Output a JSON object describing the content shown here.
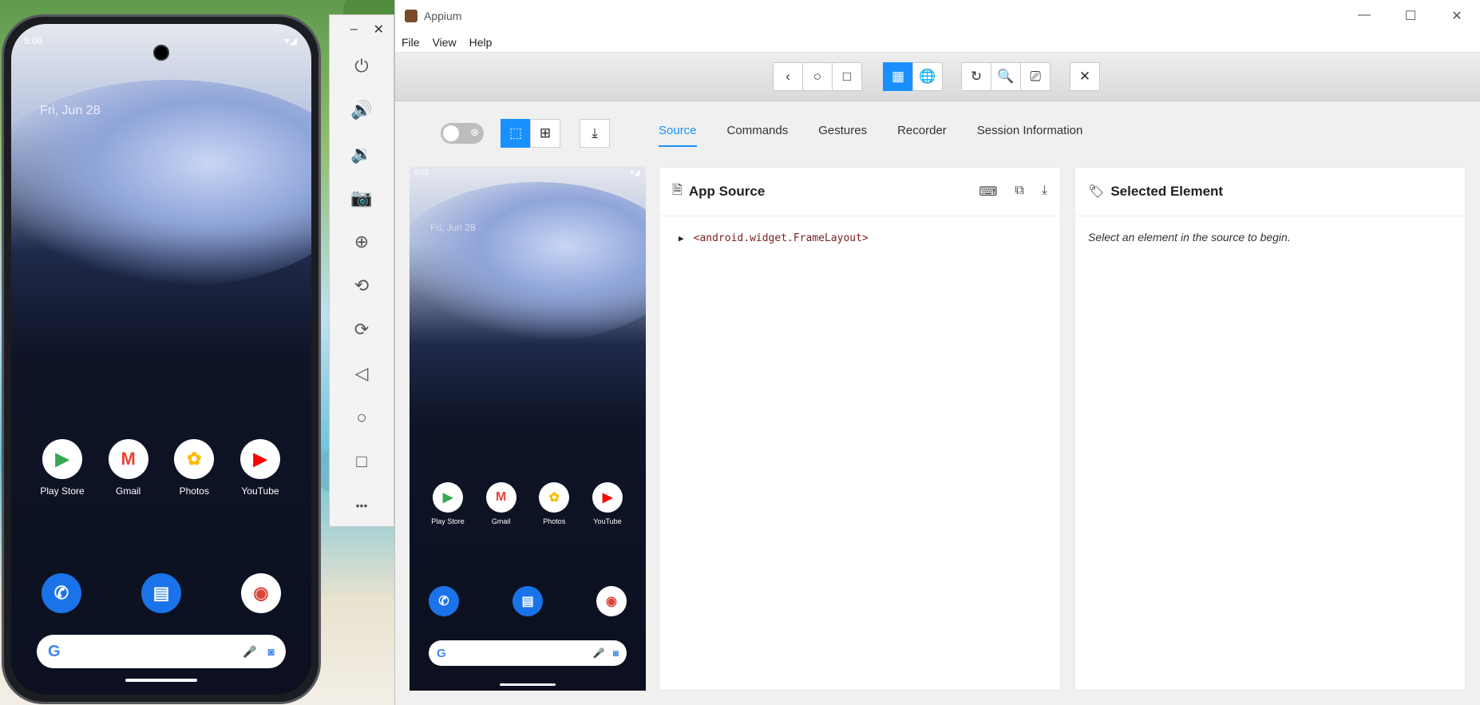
{
  "phone": {
    "status_time": "5:06",
    "date": "Fri, Jun 28",
    "apps": [
      {
        "label": "Play Store",
        "icon": "play-store-icon",
        "glyph": "▶",
        "color": "#34a853"
      },
      {
        "label": "Gmail",
        "icon": "gmail-icon",
        "glyph": "M",
        "color": "#ea4335"
      },
      {
        "label": "Photos",
        "icon": "photos-icon",
        "glyph": "✿",
        "color": "#fbbc05"
      },
      {
        "label": "YouTube",
        "icon": "youtube-icon",
        "glyph": "▶",
        "color": "#ff0000"
      }
    ],
    "dock": [
      {
        "icon": "phone-icon",
        "glyph": "✆",
        "bg": "#1a73e8"
      },
      {
        "icon": "messages-icon",
        "glyph": "▤",
        "bg": "#1a73e8"
      },
      {
        "icon": "chrome-icon",
        "glyph": "◉",
        "bg": "#ffffff"
      }
    ],
    "search_glyph": "G"
  },
  "emulator_toolbar": {
    "minimize": "–",
    "close": "✕",
    "buttons": [
      {
        "name": "power-button",
        "icon": "power-icon",
        "glyph": "⏻"
      },
      {
        "name": "volume-up-button",
        "icon": "volume-up-icon",
        "glyph": "🔊"
      },
      {
        "name": "volume-down-button",
        "icon": "volume-down-icon",
        "glyph": "🔉"
      },
      {
        "name": "screenshot-button",
        "icon": "camera-icon",
        "glyph": "📷"
      },
      {
        "name": "zoom-button",
        "icon": "zoom-icon",
        "glyph": "⊕"
      },
      {
        "name": "rotate-left-button",
        "icon": "rotate-left-icon",
        "glyph": "⟲"
      },
      {
        "name": "rotate-right-button",
        "icon": "rotate-right-icon",
        "glyph": "⟳"
      },
      {
        "name": "back-button",
        "icon": "back-triangle-icon",
        "glyph": "◁"
      },
      {
        "name": "home-button",
        "icon": "home-circle-icon",
        "glyph": "○"
      },
      {
        "name": "overview-button",
        "icon": "overview-square-icon",
        "glyph": "□"
      },
      {
        "name": "more-button",
        "icon": "more-icon",
        "glyph": "•••"
      }
    ]
  },
  "window": {
    "title": "Appium",
    "controls": {
      "minimize": "—",
      "maximize": "☐",
      "close": "✕"
    },
    "menu": [
      "File",
      "View",
      "Help"
    ]
  },
  "toolbar": {
    "nav": [
      {
        "name": "back",
        "icon": "chevron-left-icon",
        "glyph": "‹"
      },
      {
        "name": "home",
        "icon": "circle-icon",
        "glyph": "○"
      },
      {
        "name": "app-switch",
        "icon": "square-icon",
        "glyph": "□"
      }
    ],
    "context": [
      {
        "name": "native-context",
        "icon": "grid-icon",
        "glyph": "▦",
        "active": true
      },
      {
        "name": "web-context",
        "icon": "globe-icon",
        "glyph": "🌐",
        "active": false
      }
    ],
    "actions": [
      {
        "name": "refresh",
        "icon": "refresh-icon",
        "glyph": "↻"
      },
      {
        "name": "search",
        "icon": "search-icon",
        "glyph": "🔍"
      },
      {
        "name": "record",
        "icon": "video-icon",
        "glyph": "⎚"
      }
    ],
    "quit_glyph": "✕"
  },
  "inspector": {
    "toggle_off_glyph": "⊗",
    "select_glyph": "⬚",
    "tap_glyph": "⊞",
    "download_glyph": "⤓",
    "tabs": [
      "Source",
      "Commands",
      "Gestures",
      "Recorder",
      "Session Information"
    ],
    "active_tab": "Source"
  },
  "mini": {
    "status_time": "5:03",
    "date": "Fri, Jun 28",
    "apps": [
      "Play Store",
      "Gmail",
      "Photos",
      "YouTube"
    ]
  },
  "source_panel": {
    "title": "App Source",
    "tree_root": "<android.widget.FrameLayout>"
  },
  "selected_panel": {
    "title": "Selected Element",
    "hint": "Select an element in the source to begin."
  }
}
